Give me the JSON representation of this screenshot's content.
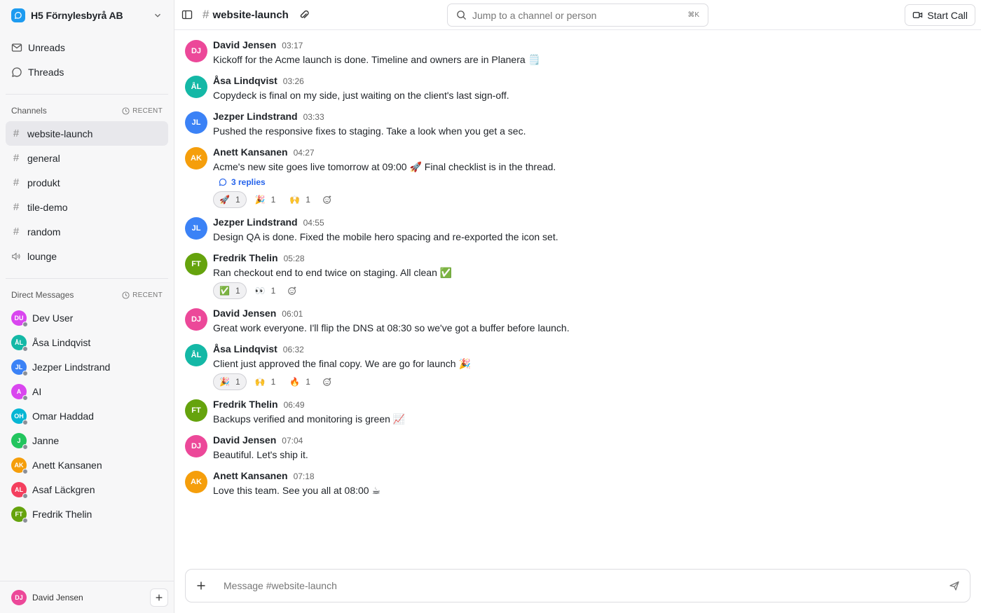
{
  "workspace": {
    "name": "H5 Förnylesbyrå AB"
  },
  "nav": [
    {
      "label": "Unreads",
      "icon": "mail-icon"
    },
    {
      "label": "Threads",
      "icon": "message-circle-icon"
    }
  ],
  "channels_section": {
    "title": "Channels",
    "recent": "RECENT"
  },
  "channels": [
    {
      "name": "website-launch",
      "active": true,
      "type": "text"
    },
    {
      "name": "general",
      "type": "text"
    },
    {
      "name": "produkt",
      "type": "text"
    },
    {
      "name": "tile-demo",
      "type": "text"
    },
    {
      "name": "random",
      "type": "text"
    },
    {
      "name": "lounge",
      "type": "voice"
    }
  ],
  "dm_section": {
    "title": "Direct Messages",
    "recent": "RECENT"
  },
  "dms": [
    {
      "name": "Dev User",
      "initials": "DU",
      "color": "#d946ef"
    },
    {
      "name": "Åsa Lindqvist",
      "initials": "ÅL",
      "color": "#14b8a6"
    },
    {
      "name": "Jezper Lindstrand",
      "initials": "JL",
      "color": "#3b82f6"
    },
    {
      "name": "AI",
      "initials": "A",
      "color": "#d946ef"
    },
    {
      "name": "Omar Haddad",
      "initials": "OH",
      "color": "#06b6d4"
    },
    {
      "name": "Janne",
      "initials": "J",
      "color": "#22c55e"
    },
    {
      "name": "Anett Kansanen",
      "initials": "AK",
      "color": "#f59e0b"
    },
    {
      "name": "Asaf Läckgren",
      "initials": "AL",
      "color": "#f43f5e"
    },
    {
      "name": "Fredrik Thelin",
      "initials": "FT",
      "color": "#65a30d"
    }
  ],
  "current_user": {
    "name": "David Jensen",
    "initials": "DJ",
    "color": "#ec4899"
  },
  "header": {
    "channel": "website-launch",
    "search_placeholder": "Jump to a channel or person",
    "search_shortcut": "⌘K",
    "call_label": "Start Call"
  },
  "messages": [
    {
      "author": "David Jensen",
      "initials": "DJ",
      "color": "#ec4899",
      "time": "03:17",
      "text": "Kickoff for the Acme launch is done. Timeline and owners are in Planera 🗒️"
    },
    {
      "author": "Åsa Lindqvist",
      "initials": "ÅL",
      "color": "#14b8a6",
      "time": "03:26",
      "text": "Copydeck is final on my side, just waiting on the client's last sign-off."
    },
    {
      "author": "Jezper Lindstrand",
      "initials": "JL",
      "color": "#3b82f6",
      "time": "03:33",
      "text": "Pushed the responsive fixes to staging. Take a look when you get a sec."
    },
    {
      "author": "Anett Kansanen",
      "initials": "AK",
      "color": "#f59e0b",
      "time": "04:27",
      "text": "Acme's new site goes live tomorrow at 09:00 🚀  Final checklist is in the thread.",
      "replies": "3 replies",
      "reactions": [
        {
          "emoji": "🚀",
          "count": "1",
          "mine": true
        },
        {
          "emoji": "🎉",
          "count": "1"
        },
        {
          "emoji": "🙌",
          "count": "1"
        }
      ]
    },
    {
      "author": "Jezper Lindstrand",
      "initials": "JL",
      "color": "#3b82f6",
      "time": "04:55",
      "text": "Design QA is done. Fixed the mobile hero spacing and re-exported the icon set."
    },
    {
      "author": "Fredrik Thelin",
      "initials": "FT",
      "color": "#65a30d",
      "time": "05:28",
      "text": "Ran checkout end to end twice on staging. All clean ✅",
      "reactions": [
        {
          "emoji": "✅",
          "count": "1",
          "mine": true
        },
        {
          "emoji": "👀",
          "count": "1"
        }
      ]
    },
    {
      "author": "David Jensen",
      "initials": "DJ",
      "color": "#ec4899",
      "time": "06:01",
      "text": "Great work everyone. I'll flip the DNS at 08:30 so we've got a buffer before launch."
    },
    {
      "author": "Åsa Lindqvist",
      "initials": "ÅL",
      "color": "#14b8a6",
      "time": "06:32",
      "text": "Client just approved the final copy. We are go for launch 🎉",
      "reactions": [
        {
          "emoji": "🎉",
          "count": "1",
          "mine": true
        },
        {
          "emoji": "🙌",
          "count": "1"
        },
        {
          "emoji": "🔥",
          "count": "1"
        }
      ]
    },
    {
      "author": "Fredrik Thelin",
      "initials": "FT",
      "color": "#65a30d",
      "time": "06:49",
      "text": "Backups verified and monitoring is green 📈"
    },
    {
      "author": "David Jensen",
      "initials": "DJ",
      "color": "#ec4899",
      "time": "07:04",
      "text": "Beautiful. Let's ship it."
    },
    {
      "author": "Anett Kansanen",
      "initials": "AK",
      "color": "#f59e0b",
      "time": "07:18",
      "text": "Love this team. See you all at 08:00 ☕"
    }
  ],
  "composer": {
    "placeholder": "Message #website-launch"
  }
}
